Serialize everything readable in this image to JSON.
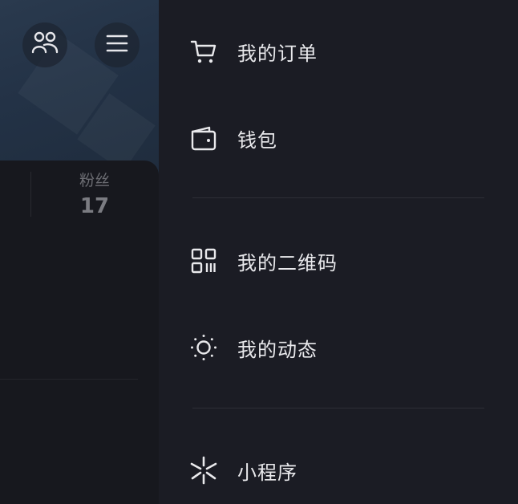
{
  "profile": {
    "stats": {
      "fans_label": "粉丝",
      "fans_count": "17"
    }
  },
  "drawer": {
    "items": [
      {
        "label": "我的订单",
        "icon": "cart-icon"
      },
      {
        "label": "钱包",
        "icon": "wallet-icon"
      },
      {
        "label": "我的二维码",
        "icon": "qr-code-icon"
      },
      {
        "label": "我的动态",
        "icon": "moments-icon"
      },
      {
        "label": "小程序",
        "icon": "mini-program-icon"
      }
    ]
  },
  "colors": {
    "drawer_bg": "#1b1c24",
    "menu_text": "#e9e9ec",
    "divider": "#2e2f37",
    "cover_bg": "#233246"
  }
}
